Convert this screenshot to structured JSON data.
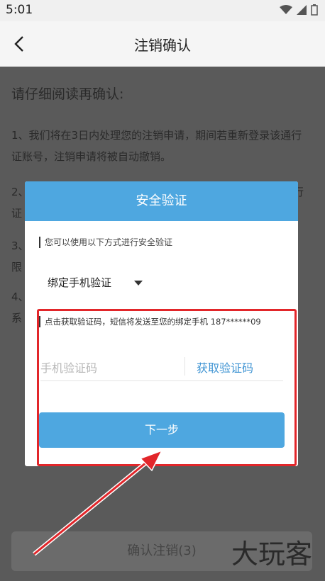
{
  "status_bar": {
    "time": "5:01"
  },
  "app_bar": {
    "title": "注销确认"
  },
  "page": {
    "heading": "请仔细阅读再确认:",
    "paragraphs": [
      "1、我们将在3日内处理您的注销申请，期间若重新登录该通行证账号，注销申请将被自动撤销。",
      "2、",
      "3、",
      "4、"
    ],
    "p2_tail": "行",
    "p2_tail2": "证",
    "p3_tail": "限",
    "p4_tail": "系",
    "confirm_button": "确认注销(3)",
    "watermark": "大玩客"
  },
  "dialog": {
    "title": "安全验证",
    "hint": "您可以使用以下方式进行安全验证",
    "method_selected": "绑定手机验证",
    "sms_hint": "点击获取验证码，短信将发送至您的绑定手机 187******09",
    "code_placeholder": "手机验证码",
    "code_value": "",
    "get_code_label": "获取验证码",
    "next_label": "下一步"
  },
  "colors": {
    "accent": "#4ea7e0",
    "annotation": "#e2262a"
  }
}
